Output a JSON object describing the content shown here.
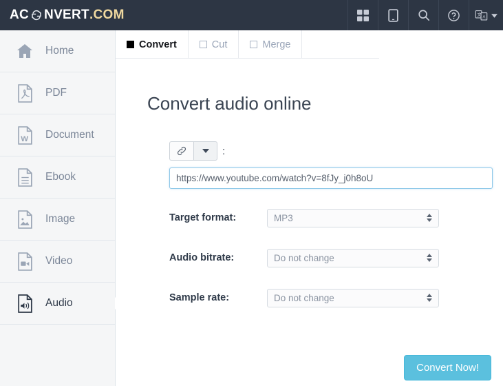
{
  "header": {
    "logo": {
      "part1": "AC",
      "icon": "recycle-icon",
      "part2": "NVERT",
      "part3": ".COM"
    },
    "tools": [
      {
        "name": "apps-grid-icon",
        "label": ""
      },
      {
        "name": "tablet-icon",
        "label": ""
      },
      {
        "name": "search-icon",
        "label": ""
      },
      {
        "name": "help-circle-icon",
        "label": ""
      },
      {
        "name": "language-translate-icon",
        "label": ""
      }
    ]
  },
  "sidebar": {
    "items": [
      {
        "label": "Home",
        "icon": "home-icon",
        "active": false
      },
      {
        "label": "PDF",
        "icon": "pdf-file-icon",
        "active": false
      },
      {
        "label": "Document",
        "icon": "word-doc-icon",
        "active": false
      },
      {
        "label": "Ebook",
        "icon": "ebook-icon",
        "active": false
      },
      {
        "label": "Image",
        "icon": "image-file-icon",
        "active": false
      },
      {
        "label": "Video",
        "icon": "video-file-icon",
        "active": false
      },
      {
        "label": "Audio",
        "icon": "audio-file-icon",
        "active": true
      }
    ]
  },
  "tabs": [
    {
      "label": "Convert",
      "active": true
    },
    {
      "label": "Cut",
      "active": false
    },
    {
      "label": "Merge",
      "active": false
    }
  ],
  "main": {
    "title": "Convert audio online",
    "source": {
      "link_button_icon": "chain-link-icon",
      "dropdown_icon": "caret-down-icon",
      "colon": ":",
      "url_value": "https://www.youtube.com/watch?v=8fJy_j0h8oU",
      "url_placeholder": ""
    },
    "fields": [
      {
        "label": "Target format:",
        "value": "MP3"
      },
      {
        "label": "Audio bitrate:",
        "value": "Do not change"
      },
      {
        "label": "Sample rate:",
        "value": "Do not change"
      }
    ],
    "submit_label": "Convert Now!"
  },
  "colors": {
    "header_bg": "#2d3644",
    "sidebar_bg": "#f5f6f7",
    "accent_button": "#5bc0de",
    "input_focus_border": "#8ec8e8",
    "label_text": "#2f3a49"
  }
}
